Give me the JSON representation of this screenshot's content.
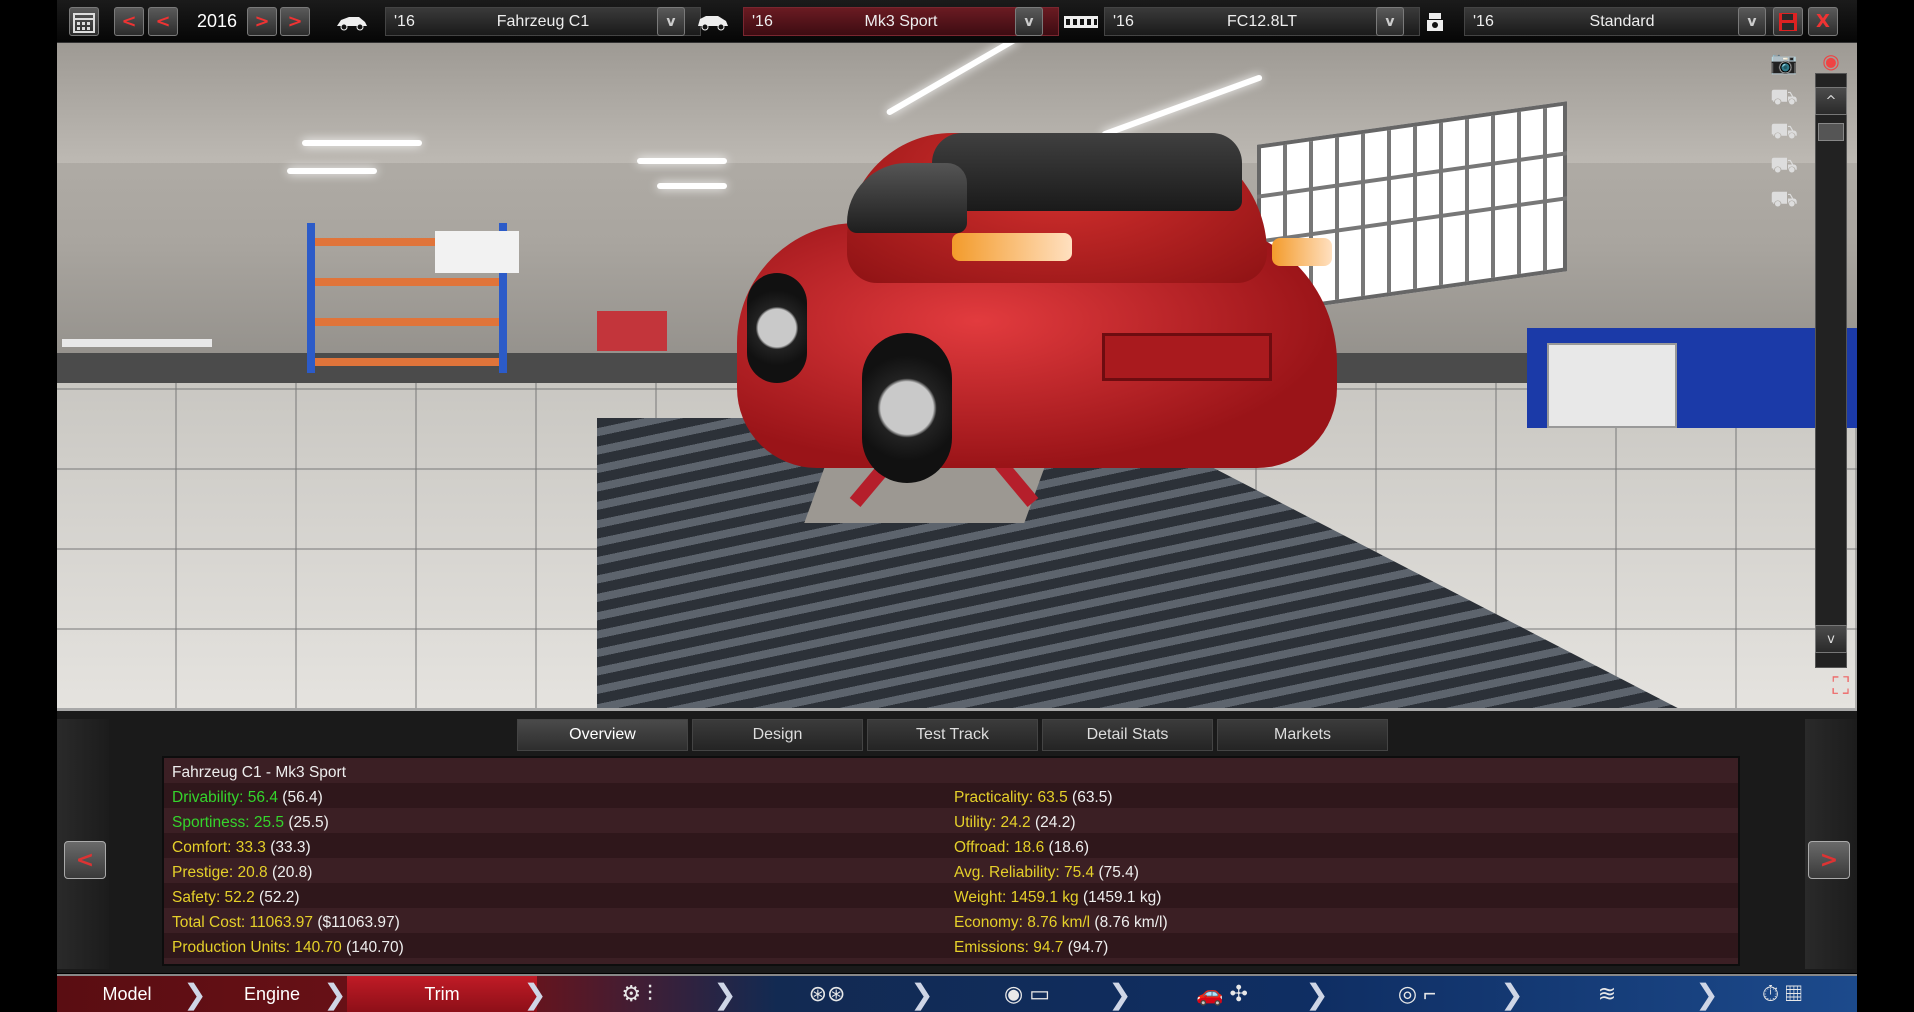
{
  "topbar": {
    "calendar_icon": "calendar-icon",
    "prev_labels": [
      "<",
      "<"
    ],
    "year": "2016",
    "next_labels": [
      ">",
      ">"
    ],
    "model": {
      "year": "'16",
      "name": "Fahrzeug C1",
      "dropdown": "v"
    },
    "trim": {
      "year": "'16",
      "name": "Mk3 Sport",
      "dropdown": "v"
    },
    "engine": {
      "year": "'16",
      "name": "FC12.8LT",
      "dropdown": "v"
    },
    "engine_variant": {
      "year": "'16",
      "name": "Standard",
      "dropdown": "v"
    },
    "close_label": "X"
  },
  "viewport": {
    "scroll_up": "^",
    "scroll_down": "v"
  },
  "panel": {
    "tabs": [
      "Overview",
      "Design",
      "Test Track",
      "Detail Stats",
      "Markets"
    ],
    "active_tab": "Overview",
    "prev": "<",
    "next": ">",
    "title": "Fahrzeug C1 - Mk3 Sport",
    "left_stats": [
      {
        "label": "Drivability: 56.4",
        "value": "(56.4)",
        "color": "green"
      },
      {
        "label": "Sportiness: 25.5",
        "value": "(25.5)",
        "color": "green"
      },
      {
        "label": "Comfort: 33.3",
        "value": "(33.3)",
        "color": "yellow"
      },
      {
        "label": "Prestige: 20.8",
        "value": "(20.8)",
        "color": "yellow"
      },
      {
        "label": "Safety: 52.2",
        "value": "(52.2)",
        "color": "yellow"
      },
      {
        "label": "Total Cost: 11063.97",
        "value": "($11063.97)",
        "color": "yellow"
      },
      {
        "label": "Production Units: 140.70",
        "value": "(140.70)",
        "color": "yellow"
      }
    ],
    "right_stats": [
      {
        "label": "Practicality: 63.5",
        "value": "(63.5)",
        "color": "yellow"
      },
      {
        "label": "Utility: 24.2",
        "value": "(24.2)",
        "color": "yellow"
      },
      {
        "label": "Offroad: 18.6",
        "value": "(18.6)",
        "color": "yellow"
      },
      {
        "label": "Avg. Reliability: 75.4",
        "value": "(75.4)",
        "color": "yellow"
      },
      {
        "label": "Weight: 1459.1 kg",
        "value": "(1459.1 kg)",
        "color": "yellow"
      },
      {
        "label": "Economy: 8.76 km/l",
        "value": "(8.76 km/l)",
        "color": "yellow"
      },
      {
        "label": "Emissions: 94.7",
        "value": "(94.7)",
        "color": "yellow"
      }
    ]
  },
  "bottomnav": {
    "model": "Model",
    "engine": "Engine",
    "trim": "Trim"
  },
  "colors": {
    "green_stat": "#35d52c",
    "yellow_stat": "#e5d02a",
    "accent_red": "#c01b26"
  }
}
